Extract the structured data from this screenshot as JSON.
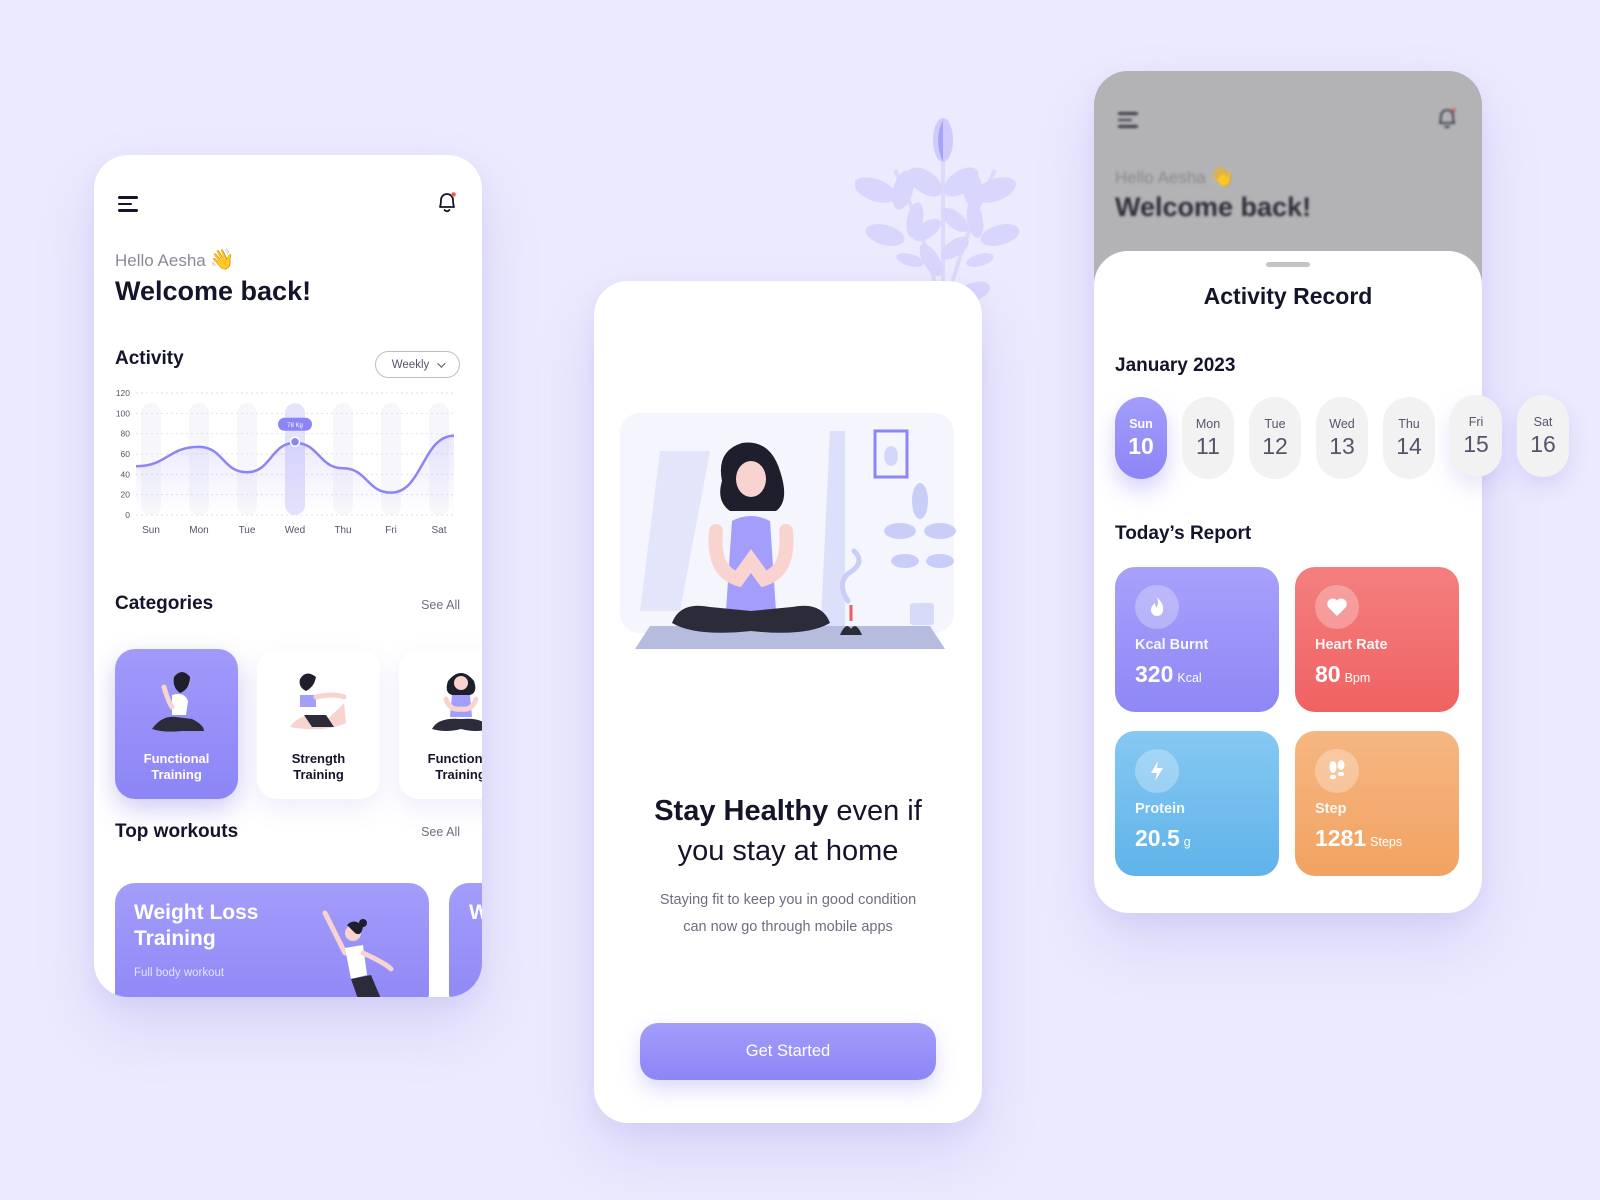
{
  "colors": {
    "background": "#ECEAFE",
    "accent": "#8C85F6",
    "heart": "#F26363",
    "protein": "#62B6EC",
    "step": "#F3A465"
  },
  "home": {
    "greeting": "Hello Aesha",
    "wave_emoji": "👋",
    "welcome": "Welcome back!",
    "menu_icon": "hamburger-icon",
    "bell_icon": "bell-icon",
    "activity": {
      "title": "Activity",
      "period_selected": "Weekly",
      "tooltip": "78 Kg"
    },
    "categories": {
      "title": "Categories",
      "see_all": "See All",
      "items": [
        {
          "label_line1": "Functional",
          "label_line2": "Training",
          "active": true
        },
        {
          "label_line1": "Strength",
          "label_line2": "Training",
          "active": false
        },
        {
          "label_line1": "Functional",
          "label_line2": "Training",
          "active": false
        }
      ]
    },
    "top_workouts": {
      "title": "Top workouts",
      "see_all": "See All",
      "items": [
        {
          "title": "Weight Loss Training",
          "subtitle": "Full body workout"
        },
        {
          "title": "W T",
          "subtitle": ""
        }
      ]
    }
  },
  "chart_data": {
    "type": "line",
    "title": "Activity",
    "categories": [
      "Sun",
      "Mon",
      "Tue",
      "Wed",
      "Thu",
      "Fri",
      "Sat"
    ],
    "x": [
      0,
      1,
      2,
      3,
      4,
      5,
      6
    ],
    "series": [
      {
        "name": "Activity",
        "values": [
          48,
          67,
          42,
          71,
          46,
          22,
          78
        ]
      }
    ],
    "yticks": [
      0,
      20,
      40,
      60,
      80,
      100,
      120
    ],
    "ylim": [
      0,
      120
    ],
    "highlighted": {
      "category": "Wed",
      "value": 72,
      "label": "78 Kg"
    },
    "grid": true,
    "xlabel": "",
    "ylabel": ""
  },
  "onboarding": {
    "headline_bold": "Stay Healthy",
    "headline_rest1": " even if",
    "headline_rest2": "you stay at home",
    "subtitle_line1": "Staying fit to keep you in good condition",
    "subtitle_line2": "can now go through mobile apps",
    "cta": "Get Started"
  },
  "activity_record": {
    "bg_greeting": "Hello Aesha",
    "bg_welcome": "Welcome back!",
    "title": "Activity Record",
    "month": "January 2023",
    "days": [
      {
        "name": "Sun",
        "num": "10",
        "active": true
      },
      {
        "name": "Mon",
        "num": "11",
        "active": false
      },
      {
        "name": "Tue",
        "num": "12",
        "active": false
      },
      {
        "name": "Wed",
        "num": "13",
        "active": false
      },
      {
        "name": "Thu",
        "num": "14",
        "active": false
      },
      {
        "name": "Fri",
        "num": "15",
        "active": false
      },
      {
        "name": "Sat",
        "num": "16",
        "active": false
      }
    ],
    "report_title": "Today’s Report",
    "stats": [
      {
        "label": "Kcal Burnt",
        "value": "320",
        "unit": "Kcal",
        "icon": "flame-icon"
      },
      {
        "label": "Heart Rate",
        "value": "80",
        "unit": "Bpm",
        "icon": "heart-icon"
      },
      {
        "label": "Protein",
        "value": "20.5",
        "unit": "g",
        "icon": "lightning-icon"
      },
      {
        "label": "Step",
        "value": "1281",
        "unit": "Steps",
        "icon": "footsteps-icon"
      }
    ]
  }
}
